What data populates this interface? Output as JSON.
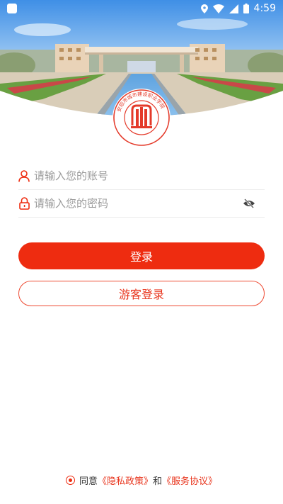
{
  "status_bar": {
    "time": "4:59",
    "icons": [
      "notification-icon",
      "location-icon",
      "wifi-icon",
      "signal-icon",
      "battery-icon"
    ]
  },
  "header": {
    "image": "campus-photo",
    "emblem": "school-emblem-logo",
    "emblem_text": "安阳市城市建设职业学院"
  },
  "login": {
    "account_placeholder": "请输入您的账号",
    "password_placeholder": "请输入您的密码",
    "login_label": "登录",
    "guest_login_label": "游客登录"
  },
  "agreement": {
    "prefix": "同意",
    "privacy_link": "《隐私政策》",
    "and": "和",
    "service_link": "《服务协议》"
  },
  "colors": {
    "accent": "#ee2c10",
    "placeholder": "#9b9b9b",
    "divider": "#ededed"
  }
}
